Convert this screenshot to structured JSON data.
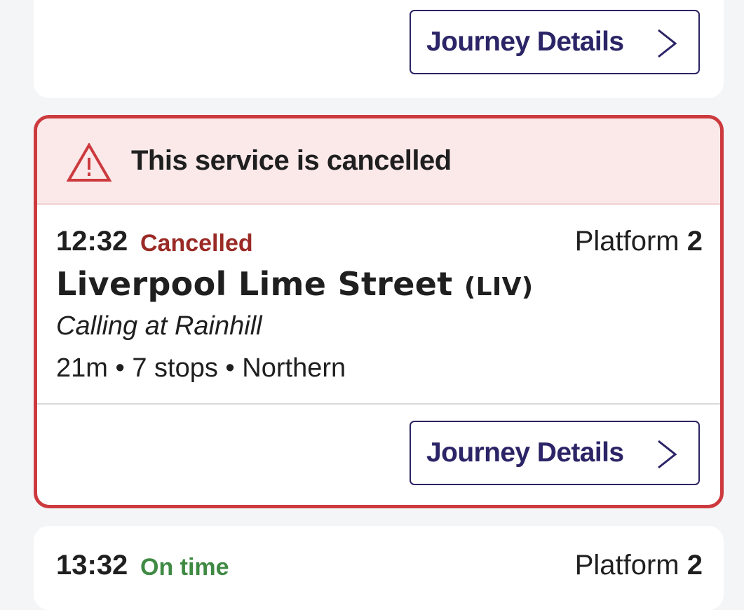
{
  "cards": {
    "top": {
      "button_label": "Journey Details"
    },
    "cancelled": {
      "alert_text": "This service is cancelled",
      "time": "12:32",
      "status": "Cancelled",
      "status_color": "#9a2a26",
      "platform_label": "Platform",
      "platform_number": "2",
      "destination": "Liverpool Lime Street",
      "destination_code": "(LIV)",
      "calling_at": "Calling at Rainhill",
      "meta": "21m • 7 stops • Northern",
      "button_label": "Journey Details",
      "border_color": "#cc3a3e",
      "alert_bg": "#fbe9ea"
    },
    "next": {
      "time": "13:32",
      "status": "On time",
      "status_color": "#3f8a43",
      "platform_label": "Platform",
      "platform_number": "2"
    }
  },
  "icons": {
    "alert": "warning-triangle-icon",
    "chevron": "chevron-right-icon"
  },
  "colors": {
    "brand": "#2b2466",
    "text": "#1f1f1f",
    "background": "#f4f5f7"
  }
}
